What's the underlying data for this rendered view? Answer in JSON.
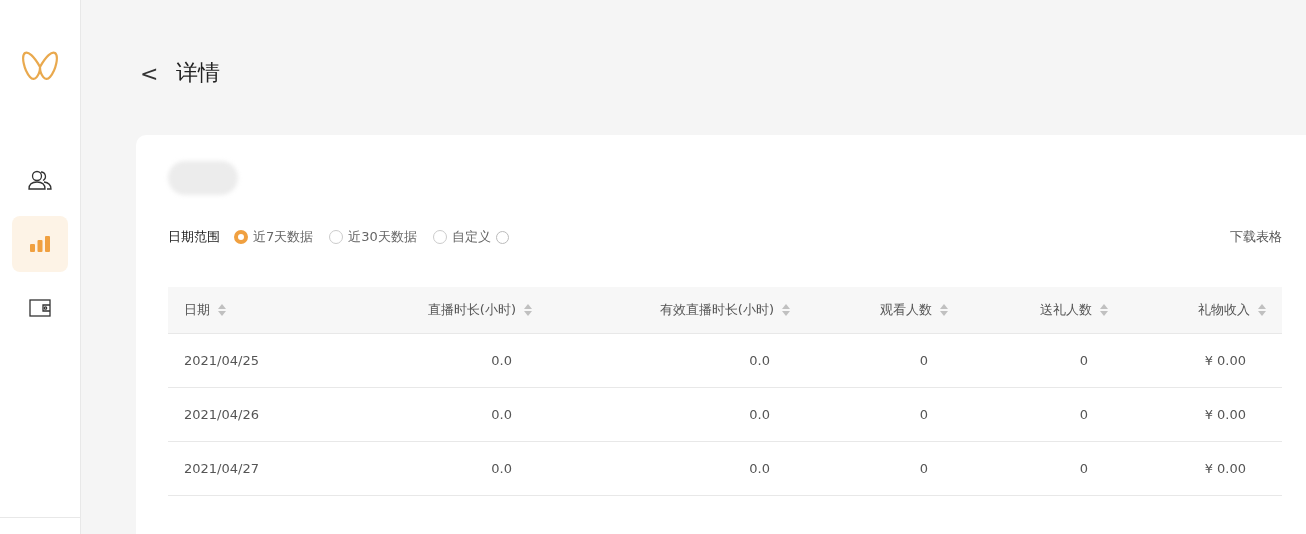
{
  "sidebar": {
    "items": [
      {
        "kind": "people",
        "selected": false
      },
      {
        "kind": "chart",
        "selected": true
      },
      {
        "kind": "wallet",
        "selected": false
      }
    ]
  },
  "header": {
    "back": "<",
    "title": "详情"
  },
  "filters": {
    "label": "日期范围",
    "options": [
      {
        "label": "近7天数据",
        "selected": true,
        "info": false
      },
      {
        "label": "近30天数据",
        "selected": false,
        "info": false
      },
      {
        "label": "自定义",
        "selected": false,
        "info": true
      }
    ],
    "download": "下载表格"
  },
  "table": {
    "columns": [
      "日期",
      "直播时长(小时)",
      "有效直播时长(小时)",
      "观看人数",
      "送礼人数",
      "礼物收入"
    ],
    "rows": [
      [
        "2021/04/25",
        "0.0",
        "0.0",
        "0",
        "0",
        "¥ 0.00"
      ],
      [
        "2021/04/26",
        "0.0",
        "0.0",
        "0",
        "0",
        "¥ 0.00"
      ],
      [
        "2021/04/27",
        "0.0",
        "0.0",
        "0",
        "0",
        "¥ 0.00"
      ]
    ]
  }
}
